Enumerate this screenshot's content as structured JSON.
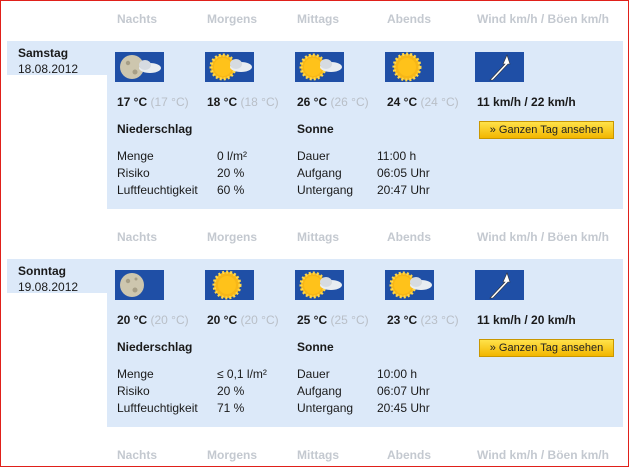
{
  "columns": [
    "Nachts",
    "Morgens",
    "Mittags",
    "Abends",
    "Wind km/h / Böen km/h"
  ],
  "days": [
    {
      "name": "Samstag",
      "date": "18.08.2012",
      "icons": [
        "moon-cloud-icon",
        "sun-cloud-icon",
        "sun-cloud-icon",
        "sun-icon"
      ],
      "temps": [
        {
          "hi": "17 °C",
          "lo": "(17 °C)"
        },
        {
          "hi": "18 °C",
          "lo": "(18 °C)"
        },
        {
          "hi": "26 °C",
          "lo": "(26 °C)"
        },
        {
          "hi": "24 °C",
          "lo": "(24 °C)"
        }
      ],
      "wind": "11 km/h / 22 km/h",
      "button": "» Ganzen Tag ansehen",
      "precip": {
        "title": "Niederschlag",
        "rows": [
          [
            "Menge",
            "0 l/m²"
          ],
          [
            "Risiko",
            "20 %"
          ],
          [
            "Luftfeuchtigkeit",
            "60 %"
          ]
        ]
      },
      "sun": {
        "title": "Sonne",
        "rows": [
          [
            "Dauer",
            "11:00 h"
          ],
          [
            "Aufgang",
            "06:05 Uhr"
          ],
          [
            "Untergang",
            "20:47 Uhr"
          ]
        ]
      }
    },
    {
      "name": "Sonntag",
      "date": "19.08.2012",
      "icons": [
        "moon-icon",
        "sun-icon",
        "sun-cloud-icon",
        "sun-cloud-icon"
      ],
      "temps": [
        {
          "hi": "20 °C",
          "lo": "(20 °C)"
        },
        {
          "hi": "20 °C",
          "lo": "(20 °C)"
        },
        {
          "hi": "25 °C",
          "lo": "(25 °C)"
        },
        {
          "hi": "23 °C",
          "lo": "(23 °C)"
        }
      ],
      "wind": "11 km/h / 20 km/h",
      "button": "» Ganzen Tag ansehen",
      "precip": {
        "title": "Niederschlag",
        "rows": [
          [
            "Menge",
            "≤ 0,1 l/m²"
          ],
          [
            "Risiko",
            "20 %"
          ],
          [
            "Luftfeuchtigkeit",
            "71 %"
          ]
        ]
      },
      "sun": {
        "title": "Sonne",
        "rows": [
          [
            "Dauer",
            "10:00 h"
          ],
          [
            "Aufgang",
            "06:07 Uhr"
          ],
          [
            "Untergang",
            "20:45 Uhr"
          ]
        ]
      }
    }
  ],
  "colors": {
    "panel": "#dce9f9",
    "header": "#c4c9d0",
    "border": "#e0201a",
    "button": "#f7c400",
    "icon_bg": "#1f4fa6"
  }
}
